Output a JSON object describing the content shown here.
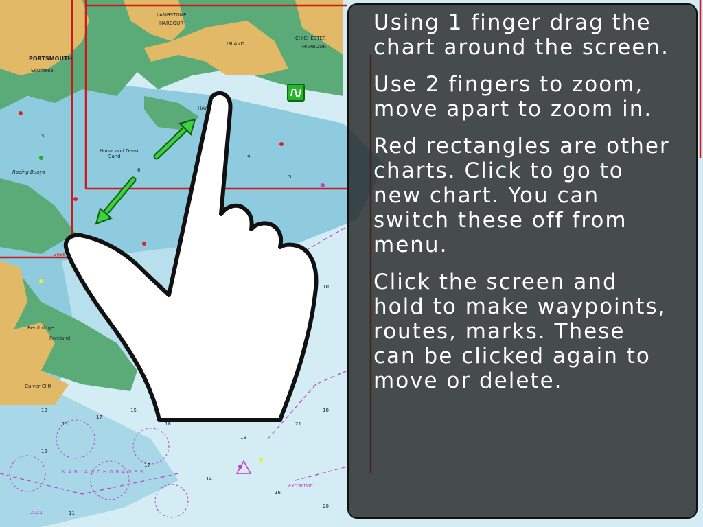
{
  "help": {
    "para1": "Using 1 finger drag the\nchart around the screen.",
    "para2": "Use 2 fingers to zoom,\nmove apart to zoom in.",
    "para3": "Red rectangles are other\ncharts. Click to go to\nnew chart. You can\nswitch these off from\nmenu.",
    "para4": "Click the screen and\nhold to make waypoints,\nroutes, marks. These\ncan be clicked again to\nmove or delete."
  },
  "chart_labels": {
    "portsmouth": "PORTSMOUTH",
    "langstone": "LANGSTONE",
    "harbour": "HARBOUR",
    "chichester": "CHICHESTER",
    "chichester_harbour": "HARBOUR",
    "southsea": "Southsea",
    "island": "ISLAND",
    "horse_dean": "Horse and Dean",
    "sand": "Sand",
    "racing_buoys": "Racing Buoys",
    "bembridge": "Bembridge",
    "foreland": "Foreland",
    "culver_cliff": "Culver Cliff",
    "anchorages": "NAB ANCHORAGES",
    "extraction": "Extraction",
    "chart_2036": "2036",
    "chart_2022": "2022",
    "hayling": "HAYLING"
  },
  "colors": {
    "land": "#e2b967",
    "marsh": "#5aab78",
    "shallow": "#8ecbdf",
    "deep": "#d5eef5",
    "chart_rect": "#cc1a1a"
  },
  "icons": {
    "hand": "pointing-hand-icon",
    "arrow_up": "green-diagonal-arrow-icon",
    "arrow_down": "green-diagonal-arrow-icon",
    "marker": "green-wave-marker-icon"
  }
}
